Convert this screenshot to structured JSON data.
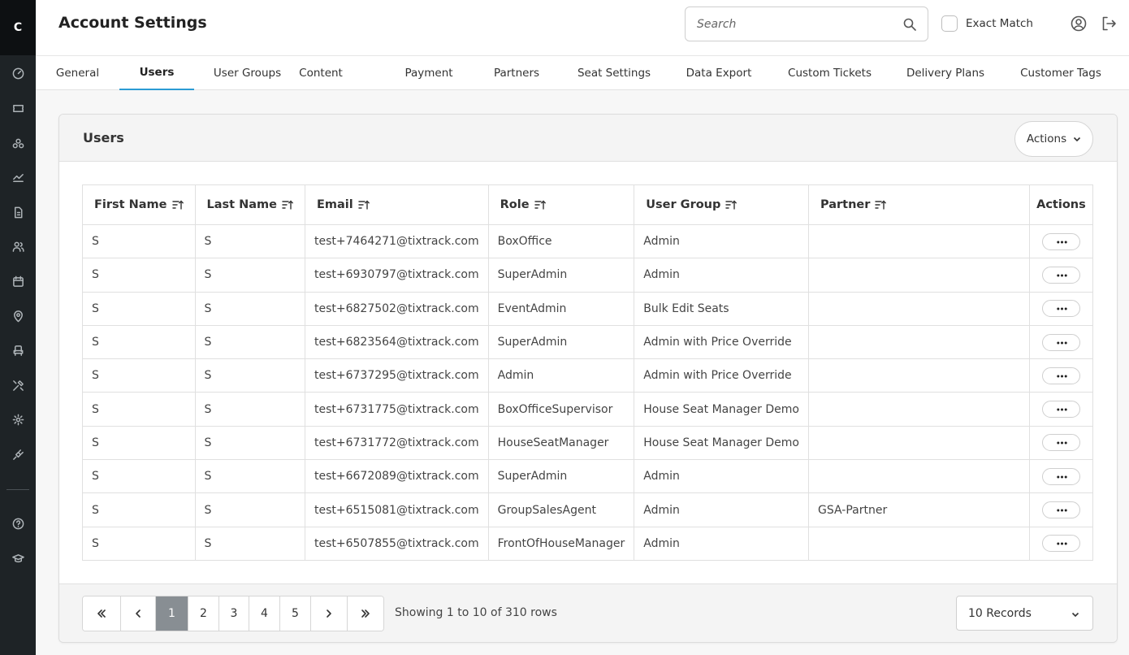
{
  "app": {
    "logo_letter": "C",
    "page_title": "Account Settings"
  },
  "sidebar": {
    "icons": [
      "dashboard-icon",
      "ticket-icon",
      "group-icon",
      "chart-icon",
      "document-icon",
      "users-icon",
      "calendar-icon",
      "location-pin-icon",
      "seat-icon",
      "tools-icon",
      "gear-icon",
      "plug-icon",
      "help-icon",
      "graduation-cap-icon"
    ]
  },
  "header": {
    "search_placeholder": "Search",
    "exact_match_label": "Exact Match",
    "exact_match_checked": false
  },
  "tabs": [
    {
      "label": "General"
    },
    {
      "label": "Users",
      "active": true
    },
    {
      "label": "User Groups"
    },
    {
      "label": "Content"
    },
    {
      "label": "Payment"
    },
    {
      "label": "Partners"
    },
    {
      "label": "Seat Settings"
    },
    {
      "label": "Data Export"
    },
    {
      "label": "Custom Tickets"
    },
    {
      "label": "Delivery Plans"
    },
    {
      "label": "Customer Tags"
    }
  ],
  "card": {
    "title": "Users",
    "actions_label": "Actions"
  },
  "table": {
    "columns": [
      "First Name",
      "Last Name",
      "Email",
      "Role",
      "User Group",
      "Partner",
      "Actions"
    ],
    "rows": [
      {
        "first": "S",
        "last": "S",
        "email": "test+7464271@tixtrack.com",
        "role": "BoxOffice",
        "group": "Admin",
        "partner": ""
      },
      {
        "first": "S",
        "last": "S",
        "email": "test+6930797@tixtrack.com",
        "role": "SuperAdmin",
        "group": "Admin",
        "partner": ""
      },
      {
        "first": "S",
        "last": "S",
        "email": "test+6827502@tixtrack.com",
        "role": "EventAdmin",
        "group": "Bulk Edit Seats",
        "partner": ""
      },
      {
        "first": "S",
        "last": "S",
        "email": "test+6823564@tixtrack.com",
        "role": "SuperAdmin",
        "group": "Admin with Price Override",
        "partner": ""
      },
      {
        "first": "S",
        "last": "S",
        "email": "test+6737295@tixtrack.com",
        "role": "Admin",
        "group": "Admin with Price Override",
        "partner": ""
      },
      {
        "first": "S",
        "last": "S",
        "email": "test+6731775@tixtrack.com",
        "role": "BoxOfficeSupervisor",
        "group": "House Seat Manager Demo",
        "partner": ""
      },
      {
        "first": "S",
        "last": "S",
        "email": "test+6731772@tixtrack.com",
        "role": "HouseSeatManager",
        "group": "House Seat Manager Demo",
        "partner": ""
      },
      {
        "first": "S",
        "last": "S",
        "email": "test+6672089@tixtrack.com",
        "role": "SuperAdmin",
        "group": "Admin",
        "partner": ""
      },
      {
        "first": "S",
        "last": "S",
        "email": "test+6515081@tixtrack.com",
        "role": "GroupSalesAgent",
        "group": "Admin",
        "partner": "GSA-Partner"
      },
      {
        "first": "S",
        "last": "S",
        "email": "test+6507855@tixtrack.com",
        "role": "FrontOfHouseManager",
        "group": "Admin",
        "partner": ""
      }
    ]
  },
  "pagination": {
    "pages": [
      "1",
      "2",
      "3",
      "4",
      "5"
    ],
    "current_page": "1",
    "showing_text": "Showing 1 to 10 of 310 rows",
    "records_per_page": "10 Records"
  },
  "colors": {
    "accent": "#2b9bd4",
    "sidebar_bg": "#1e2326",
    "active_page_bg": "#888e93"
  }
}
